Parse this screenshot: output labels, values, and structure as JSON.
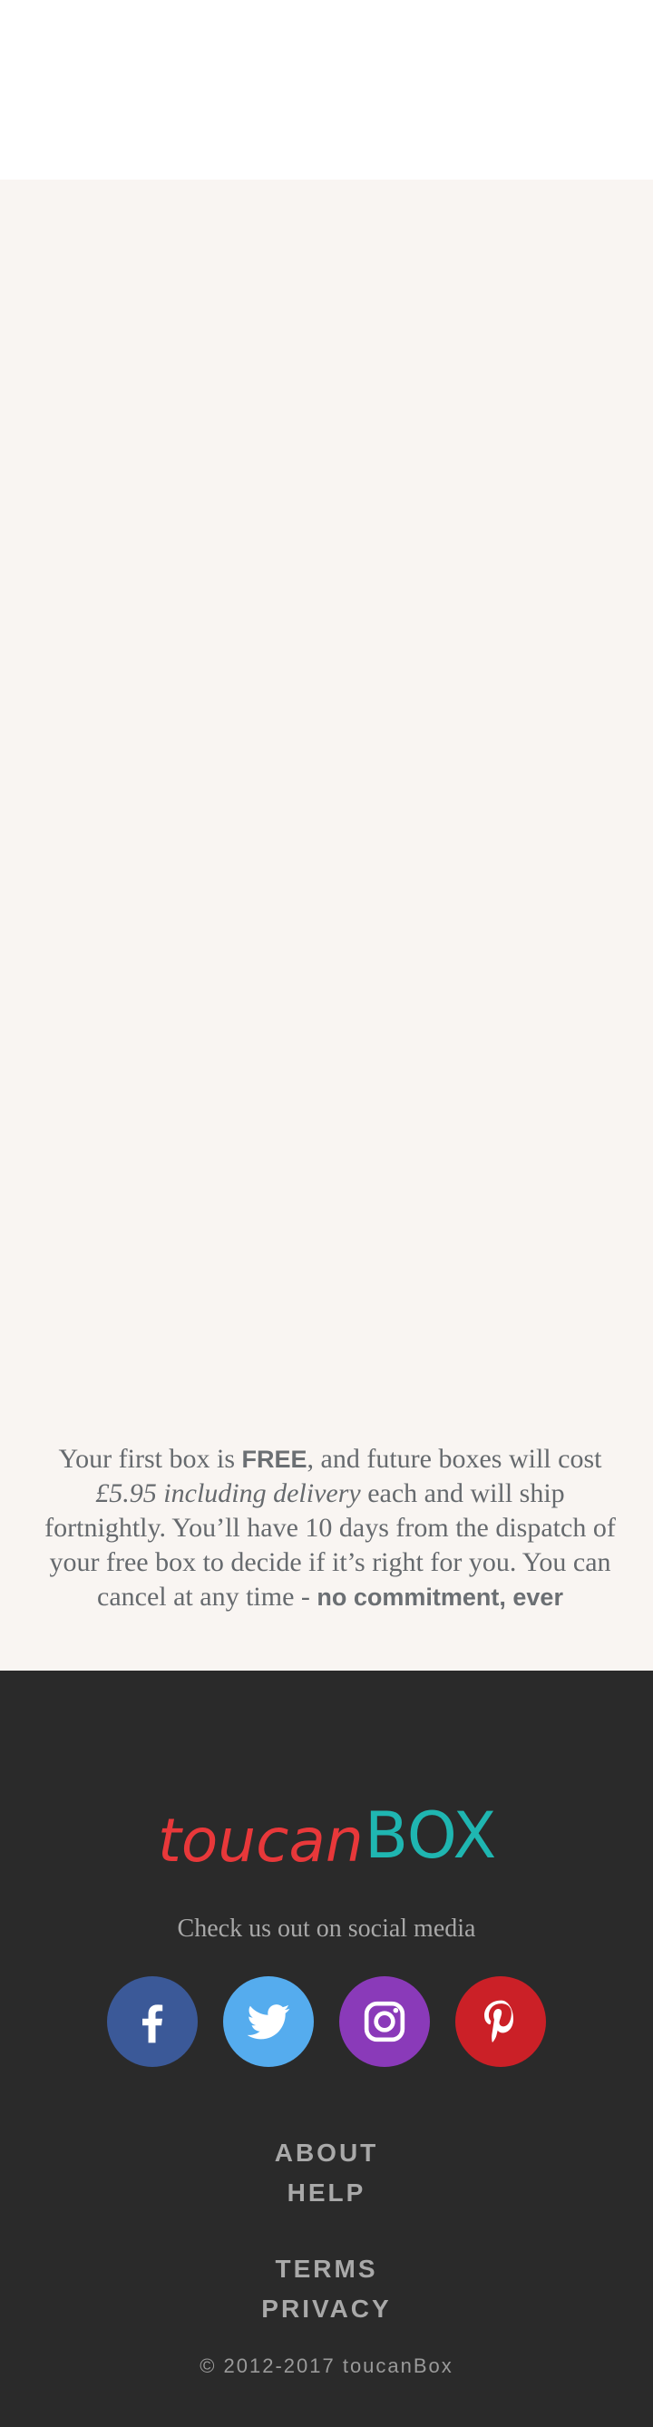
{
  "offer": {
    "part1": "Your first box is ",
    "free": "FREE",
    "part2": ", and future boxes will cost ",
    "price": "£5.95 including delivery",
    "part3": " each and will ship fortnightly. You’ll have 10 days from the dispatch of your free box to decide if it’s right for you. You can cancel at any time - ",
    "no_commitment": "no commitment, ever"
  },
  "footer": {
    "logo_text_part1": "toucan",
    "logo_text_part2": "BOX",
    "logo_colors": {
      "toucan": "#e8383a",
      "box": "#1fb6b1"
    },
    "social_heading": "Check us out on social media",
    "social": [
      {
        "name": "facebook",
        "icon": "facebook-icon",
        "color": "#3b5998"
      },
      {
        "name": "twitter",
        "icon": "twitter-icon",
        "color": "#55acee"
      },
      {
        "name": "instagram",
        "icon": "instagram-icon",
        "color": "#8a3ab9"
      },
      {
        "name": "pinterest",
        "icon": "pinterest-icon",
        "color": "#cb2027"
      }
    ],
    "nav_primary": [
      "ABOUT",
      "HELP"
    ],
    "nav_secondary": [
      "TERMS",
      "PRIVACY"
    ],
    "copyright": "© 2012-2017 toucanBox"
  }
}
